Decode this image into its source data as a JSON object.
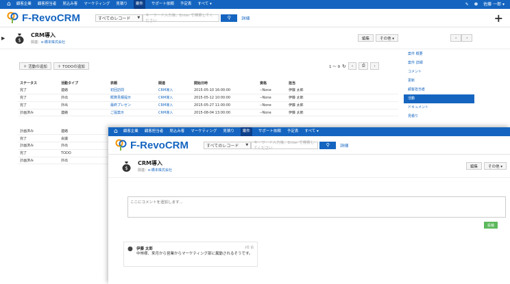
{
  "nav": {
    "items": [
      "顧客企業",
      "顧客担当者",
      "見込み客",
      "マーケティング",
      "見積り",
      "案件",
      "サポート依頼",
      "予定表",
      "すべて ▾"
    ],
    "user": "佐藤 一郎 ▾"
  },
  "header": {
    "logo": "F-RevoCRM",
    "scope": "すべてのレコード",
    "search_placeholder": "キーワード入力後、Enter で検索してください",
    "detail": "詳細"
  },
  "record": {
    "title": "CRM導入",
    "related_label": "関連：",
    "related": "e-橋本株式会社",
    "edit": "編集",
    "more": "その他 ▾"
  },
  "back": {
    "add_activity": "＋ 活動の追加",
    "add_todo": "＋ TODOの追加",
    "pager": "1 ～ 9",
    "columns": [
      "ステータス",
      "活動タイプ",
      "表題",
      "関連",
      "開始日時",
      "資格",
      "担当"
    ],
    "rows": [
      [
        "完了",
        "連絡",
        "初回訪問",
        "CRM導入",
        "2015-05-10 16:00:00",
        "--None",
        "伊藤 太郎"
      ],
      [
        "完了",
        "外出",
        "概算見積提示",
        "CRM導入",
        "2015-05-12 10:00:00",
        "--None",
        "伊藤 太郎"
      ],
      [
        "完了",
        "外出",
        "最終プレゼン",
        "CRM導入",
        "2015-05-27 11:00:00",
        "--None",
        "伊藤 太郎"
      ],
      [
        "計画済み",
        "連絡",
        "ご提案示",
        "CRM導入",
        "2015-08-04 13:00:00",
        "--None",
        "伊藤 太郎"
      ]
    ],
    "extra_rows": [
      [
        "計画済み",
        "連絡"
      ],
      [
        "完了",
        "会議"
      ],
      [
        "計画済み",
        "外出"
      ],
      [
        "完了",
        "TODO"
      ],
      [
        "計画済み",
        "外出"
      ]
    ],
    "sidebar": [
      "案件 概要",
      "案件 詳細",
      "コメント",
      "更新",
      "顧客担当者",
      "活動",
      "ドキュメント",
      "見積り"
    ],
    "sidebar_active": 5
  },
  "front": {
    "comment_placeholder": "ここにコメントを追加します...",
    "post": "投稿",
    "comment": {
      "author": "伊藤 太郎",
      "time": "3年 前",
      "text": "中林様、来月から営業からマーケティング部に異動されるそうです。"
    }
  }
}
